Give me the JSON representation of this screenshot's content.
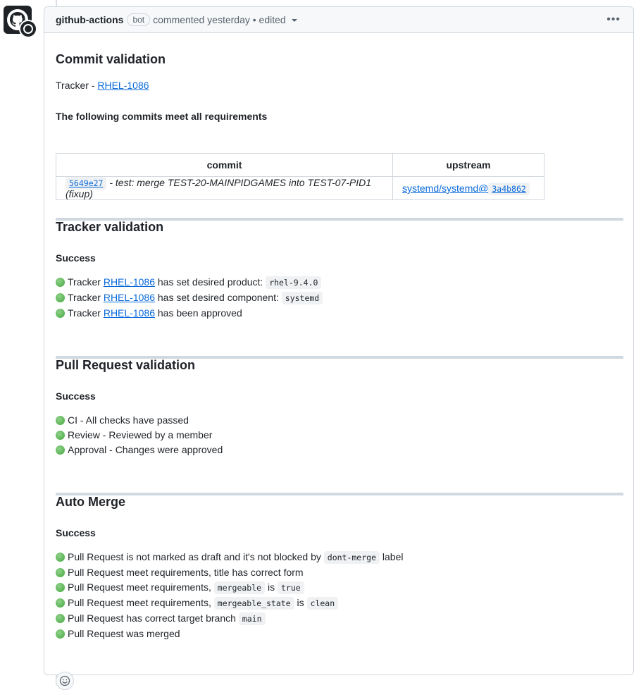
{
  "header": {
    "author": "github-actions",
    "bot_label": "bot",
    "meta": "commented yesterday • edited",
    "more": "•••"
  },
  "commit_validation": {
    "title": "Commit validation",
    "tracker_prefix": "Tracker - ",
    "tracker_link": "RHEL-1086",
    "subtitle": "The following commits meet all requirements",
    "table": {
      "headers": [
        "commit",
        "upstream"
      ],
      "rows": [
        {
          "commit_sha": "5649e27",
          "commit_msg": " - test: merge TEST-20-MAINPIDGAMES into TEST-07-PID1 (fixup)",
          "upstream_repo": "systemd/systemd@",
          "upstream_sha": "3a4b862"
        }
      ]
    }
  },
  "tracker_validation": {
    "title": "Tracker validation",
    "status": "Success",
    "items": [
      {
        "pre": "Tracker ",
        "link": "RHEL-1086",
        "post": " has set desired product: ",
        "code": "rhel-9.4.0"
      },
      {
        "pre": "Tracker ",
        "link": "RHEL-1086",
        "post": " has set desired component: ",
        "code": "systemd"
      },
      {
        "pre": "Tracker ",
        "link": "RHEL-1086",
        "post": " has been approved"
      }
    ]
  },
  "pr_validation": {
    "title": "Pull Request validation",
    "status": "Success",
    "items": [
      "CI - All checks have passed",
      "Review - Reviewed by a member",
      "Approval - Changes were approved"
    ]
  },
  "auto_merge": {
    "title": "Auto Merge",
    "status": "Success",
    "items": [
      {
        "a": "Pull Request is not marked as draft and it's not blocked by ",
        "c1": "dont-merge",
        "b": " label"
      },
      {
        "a": "Pull Request meet requirements, title has correct form"
      },
      {
        "a": "Pull Request meet requirements, ",
        "c1": "mergeable",
        "b": " is ",
        "c2": "true"
      },
      {
        "a": "Pull Request meet requirements, ",
        "c1": "mergeable_state",
        "b": " is ",
        "c2": "clean"
      },
      {
        "a": "Pull Request has correct target branch ",
        "c1": "main"
      },
      {
        "a": "Pull Request was merged"
      }
    ]
  },
  "colors": {
    "link": "#0969da",
    "success_dot": "#44a83e",
    "border": "#d0d7de"
  }
}
